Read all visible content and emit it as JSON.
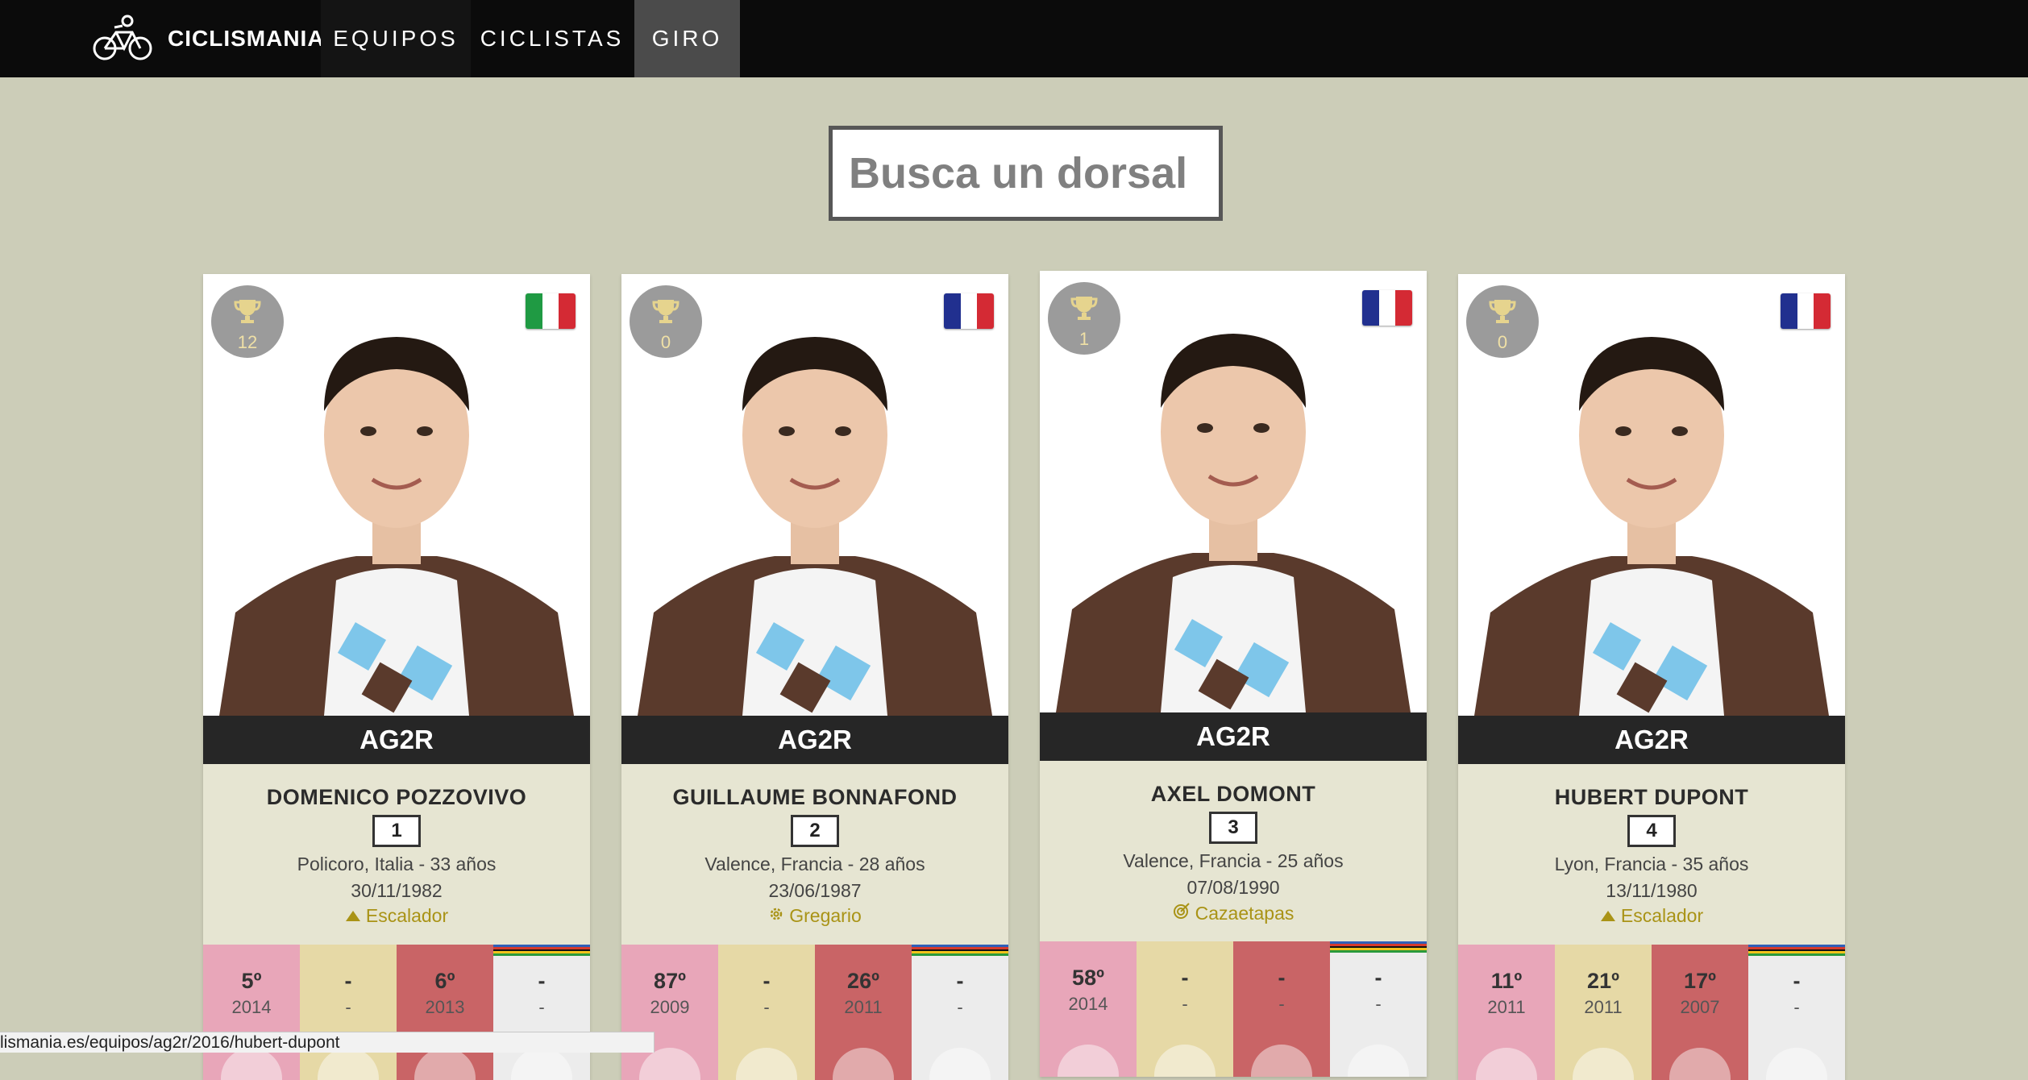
{
  "header": {
    "brand": "CICLISMANIA",
    "nav": [
      {
        "label": "EQUIPOS"
      },
      {
        "label": "CICLISTAS"
      },
      {
        "label": "GIRO"
      }
    ]
  },
  "search": {
    "placeholder": "Busca un dorsal",
    "value": ""
  },
  "riders": [
    {
      "trophies": "12",
      "flag": "italy",
      "team": "AG2R",
      "name": "DOMENICO POZZOVIVO",
      "dorsal": "1",
      "place": "Policoro, Italia - 33 años",
      "dob": "30/11/1982",
      "role": "Escalador",
      "role_icon": "mountain-icon",
      "stats": [
        {
          "pos": "5º",
          "year": "2014"
        },
        {
          "pos": "-",
          "year": "-"
        },
        {
          "pos": "6º",
          "year": "2013"
        },
        {
          "pos": "-",
          "year": "-"
        }
      ]
    },
    {
      "trophies": "0",
      "flag": "france",
      "team": "AG2R",
      "name": "GUILLAUME BONNAFOND",
      "dorsal": "2",
      "place": "Valence, Francia - 28 años",
      "dob": "23/06/1987",
      "role": "Gregario",
      "role_icon": "gear-icon",
      "stats": [
        {
          "pos": "87º",
          "year": "2009"
        },
        {
          "pos": "-",
          "year": "-"
        },
        {
          "pos": "26º",
          "year": "2011"
        },
        {
          "pos": "-",
          "year": "-"
        }
      ]
    },
    {
      "trophies": "1",
      "flag": "france",
      "team": "AG2R",
      "name": "AXEL DOMONT",
      "dorsal": "3",
      "place": "Valence, Francia - 25 años",
      "dob": "07/08/1990",
      "role": "Cazaetapas",
      "role_icon": "target-icon",
      "stats": [
        {
          "pos": "58º",
          "year": "2014"
        },
        {
          "pos": "-",
          "year": "-"
        },
        {
          "pos": "-",
          "year": "-"
        },
        {
          "pos": "-",
          "year": "-"
        }
      ]
    },
    {
      "trophies": "0",
      "flag": "france",
      "team": "AG2R",
      "name": "HUBERT DUPONT",
      "dorsal": "4",
      "place": "Lyon, Francia - 35 años",
      "dob": "13/11/1980",
      "role": "Escalador",
      "role_icon": "mountain-icon",
      "stats": [
        {
          "pos": "11º",
          "year": "2011"
        },
        {
          "pos": "21º",
          "year": "2011"
        },
        {
          "pos": "17º",
          "year": "2007"
        },
        {
          "pos": "-",
          "year": "-"
        }
      ]
    }
  ],
  "colors": {
    "background": "#cccdb8",
    "nav_active": "#4b4b4b",
    "role": "#a99316",
    "stat_pink": "#e8a6b9",
    "stat_yellow": "#e6d9a6",
    "stat_red": "#c96466",
    "stat_white": "#ececec"
  },
  "status_bar": {
    "url": "lismania.es/equipos/ag2r/2016/hubert-dupont"
  }
}
